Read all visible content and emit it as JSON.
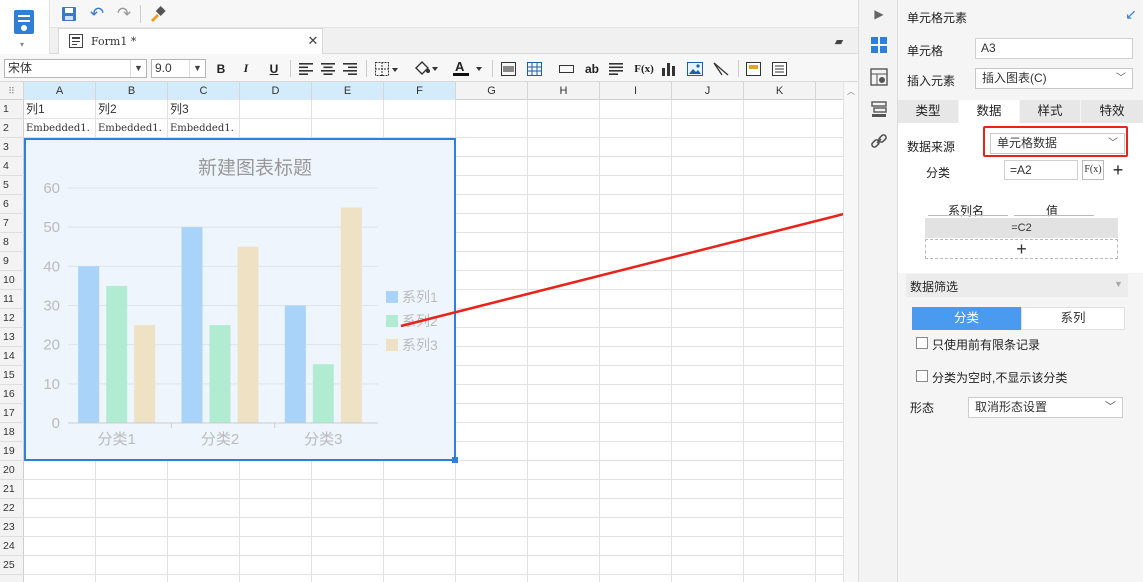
{
  "form_tab": {
    "title": "Form1 *"
  },
  "format_bar": {
    "font": "宋体",
    "size": "9.0",
    "bold": "B",
    "italic": "I",
    "underline": "U",
    "text_ab": "ab",
    "formula": "F(x)"
  },
  "columns": [
    "A",
    "B",
    "C",
    "D",
    "E",
    "F",
    "G",
    "H",
    "I",
    "J",
    "K"
  ],
  "rows": [
    "1",
    "2",
    "3",
    "4",
    "5",
    "6",
    "7",
    "8",
    "9",
    "10",
    "11",
    "12",
    "13",
    "14",
    "15",
    "16",
    "17",
    "18",
    "19",
    "20",
    "21",
    "22",
    "23",
    "24",
    "25"
  ],
  "cells": {
    "a1": "列1",
    "b1": "列2",
    "c1": "列3",
    "a2": "Embedded1.",
    "b2": "Embedded1.",
    "c2": "Embedded1."
  },
  "chart_data": {
    "type": "bar",
    "title": "新建图表标题",
    "categories": [
      "分类1",
      "分类2",
      "分类3"
    ],
    "series": [
      {
        "name": "系列1",
        "values": [
          40,
          50,
          30
        ],
        "color": "#a9d3f8"
      },
      {
        "name": "系列2",
        "values": [
          35,
          25,
          15
        ],
        "color": "#b1ecd2"
      },
      {
        "name": "系列3",
        "values": [
          25,
          45,
          55
        ],
        "color": "#efe2c4"
      }
    ],
    "yticks": [
      "0",
      "10",
      "20",
      "30",
      "40",
      "50",
      "60"
    ],
    "ylim": [
      0,
      60
    ],
    "grid": true,
    "legend": "right"
  },
  "panel": {
    "header": "单元格元素",
    "cell_label": "单元格",
    "cell_value": "A3",
    "insert_label": "插入元素",
    "insert_value": "插入图表(C)",
    "tabs": [
      "类型",
      "数据",
      "样式",
      "特效"
    ],
    "source_label": "数据来源",
    "source_value": "单元格数据",
    "category_label": "分类",
    "category_value": "=A2",
    "fx": "F(x)",
    "series_name_header": "系列名",
    "value_header": "值",
    "value_cell": "=C2",
    "filter_label": "数据筛选",
    "filter_tabs": [
      "分类",
      "系列"
    ],
    "opt1": "只使用前有限条记录",
    "opt2": "分类为空时,不显示该分类",
    "shape_label": "形态",
    "shape_value": "取消形态设置"
  },
  "colors": {
    "accent": "#2e7fe0",
    "highlight": "#e8231a",
    "tab_active": "#4a9bf0"
  }
}
